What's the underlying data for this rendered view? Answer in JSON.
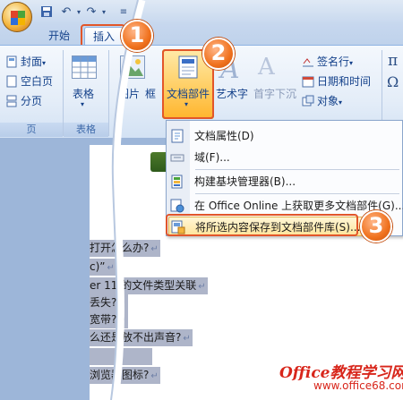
{
  "tabs": {
    "home": "开始",
    "insert": "插入"
  },
  "ribbon": {
    "pages": {
      "cover": "封面",
      "blank": "空白页",
      "break": "分页",
      "label": "页"
    },
    "table": {
      "label": "表格",
      "group": "表格"
    },
    "picture": "图片",
    "frame": "框",
    "quickparts": "文档部件",
    "wordart": "艺术字",
    "dropcap": "首字下沉",
    "signature": "签名行",
    "datetime": "日期和时间",
    "object": "对象",
    "dropdown_suffix": "▾"
  },
  "menu": {
    "items": [
      {
        "text": "文档属性(D)",
        "icon": "document-properties-icon"
      },
      {
        "text": "域(F)...",
        "icon": "field-icon"
      },
      {
        "text": "构建基块管理器(B)...",
        "icon": "building-blocks-icon"
      },
      {
        "text": "在 Office Online 上获取更多文档部件(G)...",
        "icon": "office-online-icon"
      },
      {
        "text": "将所选内容保存到文档部件库(S)...",
        "icon": "save-selection-icon"
      }
    ]
  },
  "document": {
    "lines": [
      "打开怎么办?",
      "c)”",
      "er 11 的文件类型关联",
      "丢失?",
      "宽带?",
      "么还是放不出声音?",
      "浏览器图标?"
    ],
    "para_mark": "↵"
  },
  "callouts": [
    "1",
    "2",
    "3"
  ],
  "watermark": {
    "brand": "Office教程学习网",
    "url": "www.office68.com"
  },
  "colors": {
    "accent_orange": "#f0721e",
    "ribbon_blue": "#15428b",
    "selection": "#aeb5c9",
    "watermark_red": "#d8261b"
  }
}
